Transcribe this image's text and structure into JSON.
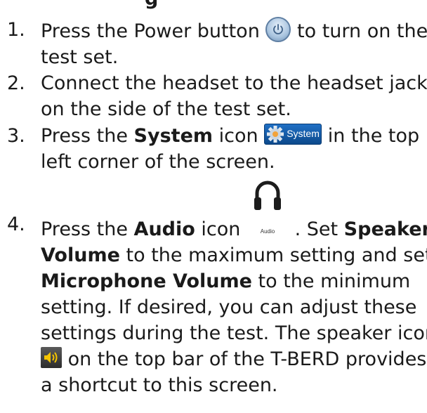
{
  "heading_fragment": "g",
  "steps": [
    {
      "number": "1.",
      "line1_before_icon": "Press the Power button",
      "line1_after_icon": "to turn on the",
      "line2": "test set."
    },
    {
      "number": "2.",
      "line1": "Connect the headset to the headset jack",
      "line2": "on the side of the test set."
    },
    {
      "number": "3.",
      "line1_prefix": "Press the",
      "line1_bold": "System",
      "line1_mid": "icon",
      "line1_suffix": "in the top",
      "line2": "left corner of the screen.",
      "icon_label": "System"
    },
    {
      "number": "4.",
      "l1_prefix": "Press the",
      "l1_bold_audio": "Audio",
      "l1_mid": "icon",
      "icon_label": "Audio",
      "l1_after_icon": ". Set",
      "l1_bold_speaker": "Speaker",
      "l2_bold": "Volume",
      "l2_rest": "to the maximum setting and set",
      "l3_bold": "Microphone Volume",
      "l3_rest": "to the minimum",
      "l4": "setting.  If desired, you can adjust these",
      "l5": "settings during the test.  The speaker icon",
      "l6_after_icon": "on the top bar of the T-BERD provides",
      "l7": "a shortcut to this screen."
    }
  ],
  "icons": {
    "power": "power-icon",
    "system": "gear-icon",
    "audio": "headphones-icon",
    "speaker": "speaker-icon"
  },
  "colors": {
    "text": "#1a1a1a",
    "system_icon_bg": "#1f6fc4",
    "speaker_icon_bg": "#3a3a3a",
    "speaker_glyph": "#f5c400"
  }
}
